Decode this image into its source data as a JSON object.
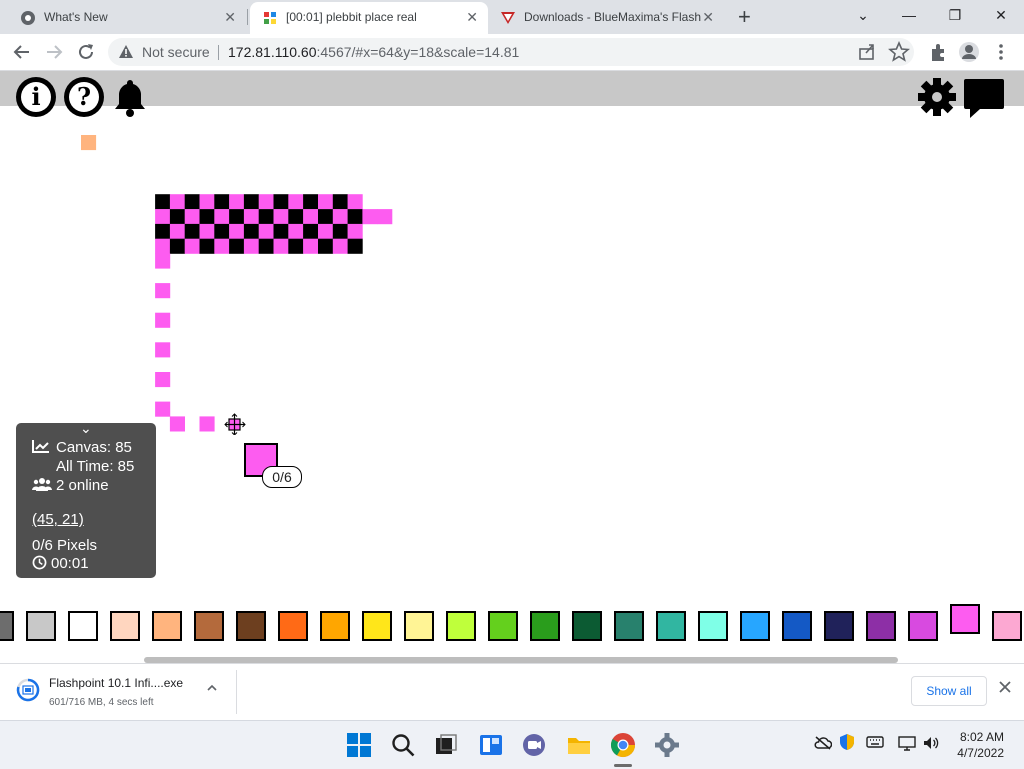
{
  "browser": {
    "tabs": [
      {
        "title": "What's New",
        "favicon": "chrome-icon"
      },
      {
        "title": "[00:01] plebbit place real",
        "favicon": "colorful-grid-icon"
      },
      {
        "title": "Downloads - BlueMaxima's Flash",
        "favicon": "flashpoint-icon"
      }
    ],
    "tab_close_glyph": "✕",
    "new_tab_glyph": "+",
    "window_controls": {
      "collapse": "⌄",
      "minimize": "—",
      "restore": "❐",
      "close": "✕"
    },
    "security_label": "Not secure",
    "url_host": "172.81.110.60",
    "url_rest": ":4567/#x=64&y=18&scale=14.81"
  },
  "app": {
    "stats": {
      "collapse_glyph": "⌄",
      "canvas": "Canvas: 85",
      "all_time": "All Time: 85",
      "online": "2 online",
      "coords": "(45, 21)",
      "pixels": "0/6 Pixels",
      "timer": "00:01"
    },
    "pixel_count": "0/6",
    "selected_color": "#fd5cf0",
    "palette": [
      "#6d6d6d",
      "#c8c8c8",
      "#ffffff",
      "#ffd6bf",
      "#ffb47e",
      "#b46a3c",
      "#6d3f1f",
      "#ff6a16",
      "#ffa600",
      "#ffe61a",
      "#fff495",
      "#bfff3b",
      "#64d01d",
      "#2a9d1c",
      "#0c5b33",
      "#28816d",
      "#31b6a1",
      "#7fffe7",
      "#27a6ff",
      "#1459c5",
      "#20225a",
      "#8d2fa6",
      "#d84ae0",
      "#fd5cf0",
      "#fca8d2"
    ]
  },
  "download": {
    "file": "Flashpoint 10.1 Infi....exe",
    "progress": "601/716 MB, 4 secs left",
    "show_all": "Show all"
  },
  "taskbar": {
    "time": "8:02 AM",
    "date": "4/7/2022"
  }
}
